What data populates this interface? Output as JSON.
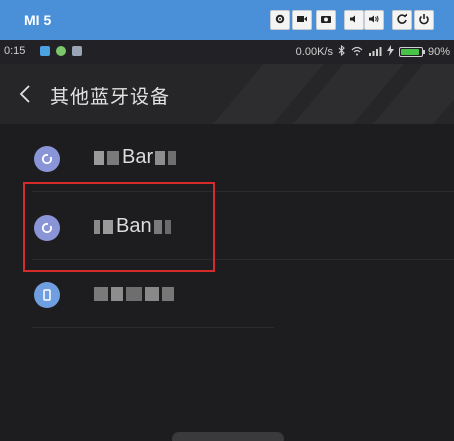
{
  "emulator": {
    "title": "MI 5",
    "buttons": [
      "settings-icon",
      "video-icon",
      "camera-icon",
      "volume-down-icon",
      "volume-up-icon",
      "rotate-icon",
      "power-icon"
    ]
  },
  "status_bar": {
    "time": "0:15",
    "speed": "0.00K/s",
    "battery": "90%",
    "battery_level": 0.9
  },
  "header": {
    "title": "其他蓝牙设备"
  },
  "devices": [
    {
      "name_visible": "Bar",
      "icon": "bluetooth-device-icon"
    },
    {
      "name_visible": "Ban",
      "icon": "bluetooth-device-icon"
    },
    {
      "name_visible": "",
      "icon": "phone-icon"
    }
  ],
  "colors": {
    "emulator_bar": "#4a90d9",
    "background": "#1d1d1f",
    "device_icon": "#8a95d8",
    "highlight": "#d62b2b",
    "battery_fill": "#47c447"
  }
}
